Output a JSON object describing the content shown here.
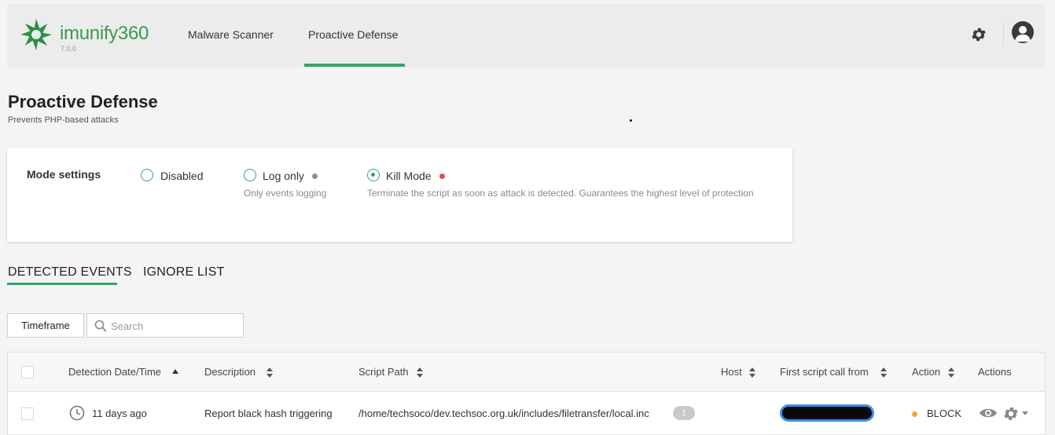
{
  "app": {
    "name": "imunify360",
    "version": "7.0.0",
    "brand_color": "#3a9a4c",
    "accent_color": "#2fa66a"
  },
  "nav": {
    "items": [
      {
        "label": "Malware Scanner",
        "active": false
      },
      {
        "label": "Proactive Defense",
        "active": true
      }
    ],
    "settings_icon": "gear-icon",
    "user_icon": "user-avatar-icon"
  },
  "page": {
    "title": "Proactive Defense",
    "subtitle": "Prevents PHP-based attacks"
  },
  "mode_settings": {
    "label": "Mode settings",
    "options": [
      {
        "label": "Disabled",
        "hint": "",
        "selected": false,
        "dot_color": ""
      },
      {
        "label": "Log only",
        "hint": "Only events logging",
        "selected": false,
        "dot_color": "#8e8e8e"
      },
      {
        "label": "Kill Mode",
        "hint": "Terminate the script as soon as attack is detected. Guarantees the highest level of protection",
        "selected": true,
        "dot_color": "#e84a4a"
      }
    ]
  },
  "tabs": [
    {
      "label": "DETECTED EVENTS",
      "active": true
    },
    {
      "label": "IGNORE LIST",
      "active": false
    }
  ],
  "filters": {
    "timeframe_label": "Timeframe",
    "search_placeholder": "Search",
    "search_value": ""
  },
  "table": {
    "columns": [
      {
        "label": "Detection Date/Time",
        "sort": "asc"
      },
      {
        "label": "Description",
        "sort": "both"
      },
      {
        "label": "Script Path",
        "sort": "both"
      },
      {
        "label": "Host",
        "sort": "both"
      },
      {
        "label": "First script call from",
        "sort": "both"
      },
      {
        "label": "Action",
        "sort": "both"
      },
      {
        "label": "Actions",
        "sort": ""
      }
    ],
    "rows": [
      {
        "date": "11 days ago",
        "description": "Report black hash triggering",
        "script_path": "/home/techsoco/dev.techsoc.org.uk/includes/filetransfer/local.inc",
        "count": "1",
        "host": "",
        "action": "BLOCK",
        "action_color": "#f4a62a"
      }
    ]
  }
}
